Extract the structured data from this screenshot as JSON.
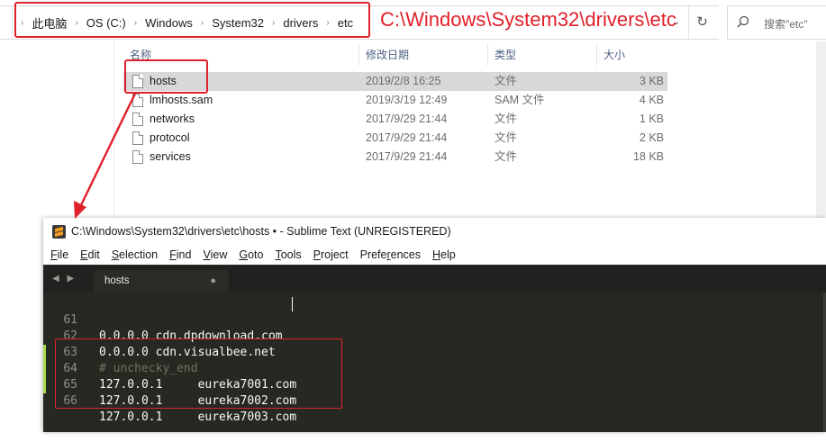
{
  "explorer": {
    "breadcrumb": [
      "此电脑",
      "OS (C:)",
      "Windows",
      "System32",
      "drivers",
      "etc"
    ],
    "path_annotation": "C:\\Windows\\System32\\drivers\\etc",
    "search_placeholder": "搜索\"etc\"",
    "columns": {
      "name": "名称",
      "date": "修改日期",
      "type": "类型",
      "size": "大小"
    },
    "files": [
      {
        "name": "hosts",
        "date": "2019/2/8 16:25",
        "type": "文件",
        "size": "3 KB",
        "selected": true
      },
      {
        "name": "lmhosts.sam",
        "date": "2019/3/19 12:49",
        "type": "SAM 文件",
        "size": "4 KB"
      },
      {
        "name": "networks",
        "date": "2017/9/29 21:44",
        "type": "文件",
        "size": "1 KB"
      },
      {
        "name": "protocol",
        "date": "2017/9/29 21:44",
        "type": "文件",
        "size": "2 KB"
      },
      {
        "name": "services",
        "date": "2017/9/29 21:44",
        "type": "文件",
        "size": "18 KB"
      }
    ]
  },
  "sublime": {
    "title": "C:\\Windows\\System32\\drivers\\etc\\hosts • - Sublime Text (UNREGISTERED)",
    "menu": [
      {
        "ul": "F",
        "rest": "ile"
      },
      {
        "ul": "E",
        "rest": "dit"
      },
      {
        "ul": "S",
        "rest": "election"
      },
      {
        "ul": "F",
        "rest": "ind"
      },
      {
        "ul": "V",
        "rest": "iew"
      },
      {
        "ul": "G",
        "rest": "oto"
      },
      {
        "ul": "T",
        "rest": "ools"
      },
      {
        "ul": "P",
        "rest": "roject"
      },
      {
        "ul": "P",
        "rest": "references",
        "pre": "Prefe",
        "mid": "r",
        "post": "ences"
      },
      {
        "ul": "H",
        "rest": "elp"
      }
    ],
    "tab_nav": "◀ ▶",
    "tab_label": "hosts",
    "tab_dirty": "●",
    "lines": [
      {
        "num": "61",
        "text": "0.0.0.0 cdn.dpdownload.com",
        "kind": "normal"
      },
      {
        "num": "62",
        "text": "0.0.0.0 cdn.visualbee.net",
        "kind": "normal"
      },
      {
        "num": "63",
        "text": "# unchecky_end",
        "kind": "comment"
      },
      {
        "num": "64",
        "text": "127.0.0.1     eureka7001.com",
        "kind": "added"
      },
      {
        "num": "65",
        "text": "127.0.0.1     eureka7002.com",
        "kind": "added"
      },
      {
        "num": "66",
        "text": "127.0.0.1     eureka7003.com",
        "kind": "added"
      }
    ]
  },
  "colors": {
    "annotation_red": "#e0202a",
    "editor_bg": "#272822",
    "diff_added": "#a6d945"
  }
}
